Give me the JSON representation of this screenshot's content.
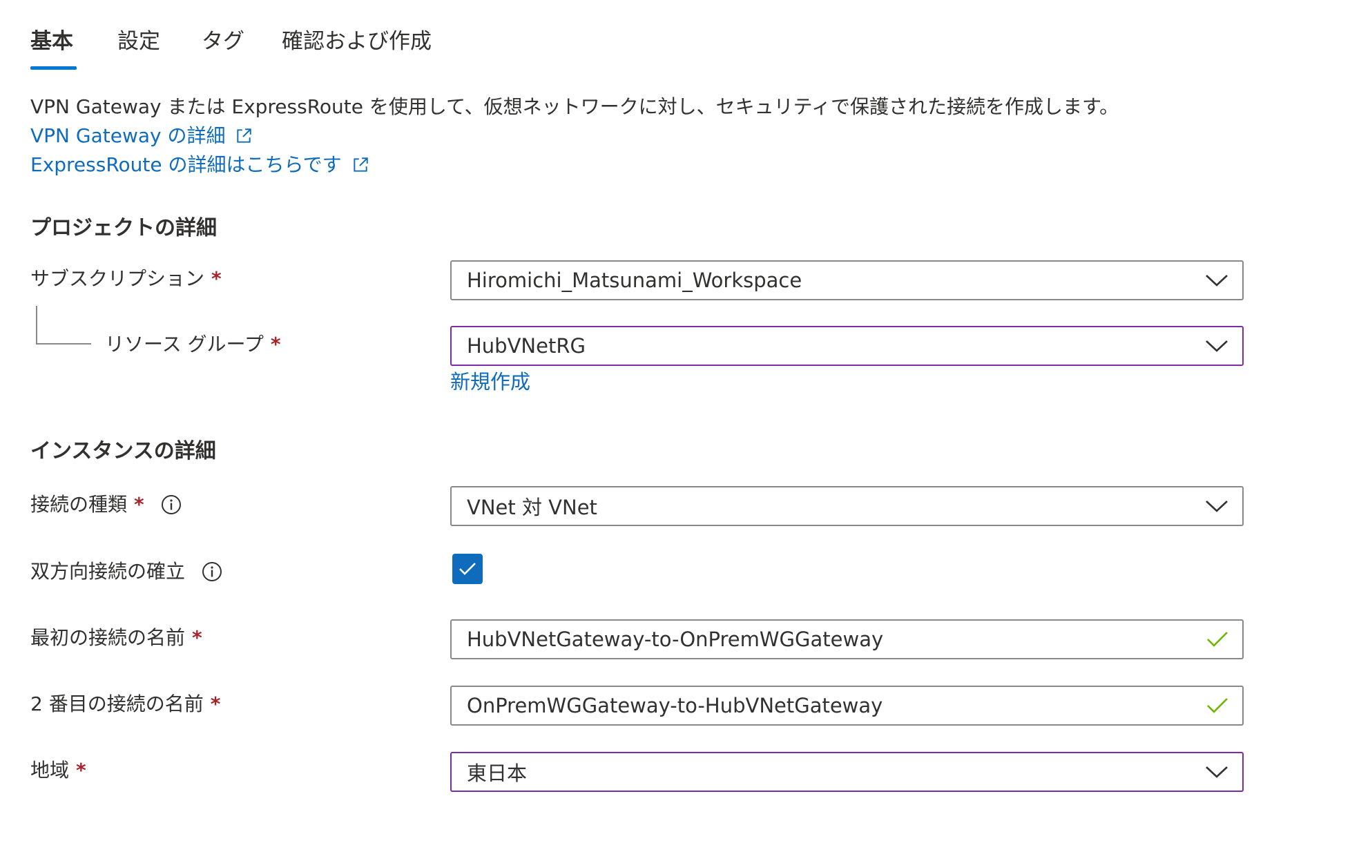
{
  "tabs": [
    {
      "label": "基本",
      "active": true
    },
    {
      "label": "設定",
      "active": false
    },
    {
      "label": "タグ",
      "active": false
    },
    {
      "label": "確認および作成",
      "active": false
    }
  ],
  "intro": {
    "description": "VPN Gateway または ExpressRoute を使用して、仮想ネットワークに対し、セキュリティで保護された接続を作成します。",
    "link_vpn": "VPN Gateway の詳細",
    "link_expressroute": "ExpressRoute の詳細はこちらです"
  },
  "project": {
    "title": "プロジェクトの詳細",
    "subscription_label": "サブスクリプション",
    "subscription_value": "Hiromichi_Matsunami_Workspace",
    "resource_group_label": "リソース グループ",
    "resource_group_value": "HubVNetRG",
    "create_new_link": "新規作成"
  },
  "instance": {
    "title": "インスタンスの詳細",
    "connection_type_label": "接続の種類",
    "connection_type_value": "VNet 対 VNet",
    "bidirectional_label": "双方向接続の確立",
    "bidirectional_checked": true,
    "first_name_label": "最初の接続の名前",
    "first_name_value": "HubVNetGateway-to-OnPremWGGateway",
    "second_name_label": "2 番目の接続の名前",
    "second_name_value": "OnPremWGGateway-to-HubVNetGateway",
    "region_label": "地域",
    "region_value": "東日本"
  },
  "required_marker": "*",
  "colors": {
    "accent": "#0f6cbd",
    "tab_underline": "#0078d4",
    "focus_border": "#7b2ba6",
    "required": "#a4262c",
    "valid_check": "#6bb700"
  },
  "icons": {
    "external_link": "external-link-icon",
    "info": "info-icon",
    "dropdown": "chevron-down-icon",
    "valid": "checkmark-icon"
  }
}
